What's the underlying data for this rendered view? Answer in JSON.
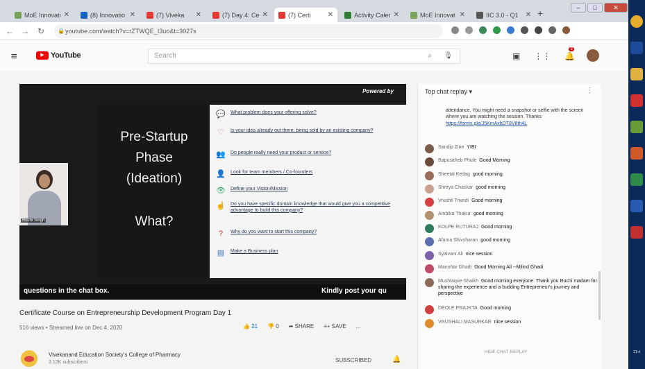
{
  "browser": {
    "tabs": [
      {
        "label": "MoE Innovati",
        "icon_color": "#7aa35a",
        "active": false
      },
      {
        "label": "(8) Innovatio",
        "icon_color": "#1565c0",
        "active": false
      },
      {
        "label": "(7) Viveka",
        "icon_color": "#e53935",
        "active": false
      },
      {
        "label": "(7) Day 4: Ce",
        "icon_color": "#e53935",
        "active": false
      },
      {
        "label": "(7) Certi",
        "icon_color": "#e53935",
        "active": true
      },
      {
        "label": "Activity Caler",
        "icon_color": "#2e7d32",
        "active": false
      },
      {
        "label": "MoE Innovat",
        "icon_color": "#7aa35a",
        "active": false
      },
      {
        "label": "IIC 3.0 - Q1",
        "icon_color": "#555555",
        "active": false
      }
    ],
    "url": "youtube.com/watch?v=rZTWQE_I3uo&t=3027s"
  },
  "youtube": {
    "logo_text": "YouTube",
    "search_placeholder": "Search",
    "notification_count": "9"
  },
  "video": {
    "powered_by": "Powered by",
    "presenter_name": "Ruchi Singh",
    "slide": {
      "title_lines": [
        "Pre-Startup",
        "Phase",
        "(Ideation)",
        "What?"
      ],
      "questions": [
        {
          "icon": "💬",
          "color": "#e8912c",
          "text": "What problem does your offering solve?"
        },
        {
          "icon": "♡",
          "color": "#d06aa0",
          "text": "Is your idea already out there, being sold by an existing company?"
        },
        {
          "icon": "👥",
          "color": "#f0a030",
          "text": "Do people really need your product or service?"
        },
        {
          "icon": "👤",
          "color": "#3d86c6",
          "text": "Look for team members / Co-founders"
        },
        {
          "icon": "👁",
          "color": "#3aa86a",
          "text": "Define your Vision/Mission"
        },
        {
          "icon": "☝",
          "color": "#666666",
          "text": "Do you have specific domain knowledge that would give you a competitive advantage to build this company?"
        },
        {
          "icon": "?",
          "color": "#e03030",
          "text": "Why do you want to start this company?"
        },
        {
          "icon": "▤",
          "color": "#3d6fb6",
          "text": "Make a  Business plan"
        }
      ]
    },
    "ticker_left": "questions in the chat box.",
    "ticker_right": "Kindly post your qu",
    "title": "Certificate Course on Entrepreneurship Development Program Day 1",
    "meta": "516 views • Streamed live on Dec 4, 2020",
    "likes": "21",
    "dislikes": "0",
    "share_label": "SHARE",
    "save_label": "SAVE",
    "more_label": "...",
    "channel_name": "Vivekanand Education Society's College of Pharmacy",
    "subscribers": "3.12K subscribers",
    "subscribed_label": "SUBSCRIBED"
  },
  "chat": {
    "header": "Top chat replay",
    "pinned_text": "attendance. You might need a snapshot or selfie with the screen where you are watching the session. Thanks",
    "pinned_link": "https://forms.gle/J5KmAxhDT8V8th4L",
    "messages": [
      {
        "author": "Sandip Zine",
        "text": "YIBI",
        "avatar_color": "#7a5a48"
      },
      {
        "author": "Bapusaheb Phule",
        "text": "Good Morning",
        "avatar_color": "#6a4a3a"
      },
      {
        "author": "Sheetal Kedag",
        "text": "good morning",
        "avatar_color": "#9a6a5a"
      },
      {
        "author": "Shreya Chaskar",
        "text": "good morning",
        "avatar_color": "#c8a090"
      },
      {
        "author": "Vrushti Trivedi",
        "text": "Good morning",
        "avatar_color": "#d84040"
      },
      {
        "author": "Ambika Thakur",
        "text": "good morning",
        "avatar_color": "#b09070"
      },
      {
        "author": "KOLPE RUTURAJ",
        "text": "Good morning",
        "avatar_color": "#2e7d5a"
      },
      {
        "author": "Afama Shivsharan",
        "text": "good morning",
        "avatar_color": "#5b6fb0"
      },
      {
        "author": "Syalvani Ali",
        "text": "nice session",
        "avatar_color": "#7b5fa8"
      },
      {
        "author": "Manohar Ghadi",
        "text": "Good Morning All --Milind Ghadi",
        "avatar_color": "#c04a6a"
      },
      {
        "author": "Mushtaque Shaikh",
        "text": "Good morning everyone. Thank you Ruchi madam for sharing the experience and a budding Entrepreneur's journey and perspective",
        "avatar_color": "#8a6a5a"
      },
      {
        "author": "DEOLE PRAJKTA",
        "text": "Good morning",
        "avatar_color": "#d04040"
      },
      {
        "author": "VRUSHALI MASURKAR",
        "text": "nice session",
        "avatar_color": "#e08a2c"
      }
    ],
    "hide_label": "HIDE CHAT REPLAY"
  },
  "taskbar": {
    "icons": [
      {
        "name": "chrome",
        "color": "#e6ad2c"
      },
      {
        "name": "save",
        "color": "#1e4a9a"
      },
      {
        "name": "folder",
        "color": "#e0b040"
      },
      {
        "name": "pdf",
        "color": "#d03030"
      },
      {
        "name": "app",
        "color": "#6a9a3a"
      },
      {
        "name": "powerpoint",
        "color": "#d05a2a"
      },
      {
        "name": "excel",
        "color": "#2e8a4a"
      },
      {
        "name": "word",
        "color": "#2a5ab0"
      },
      {
        "name": "other",
        "color": "#c03030"
      }
    ],
    "clock": "21:4"
  }
}
